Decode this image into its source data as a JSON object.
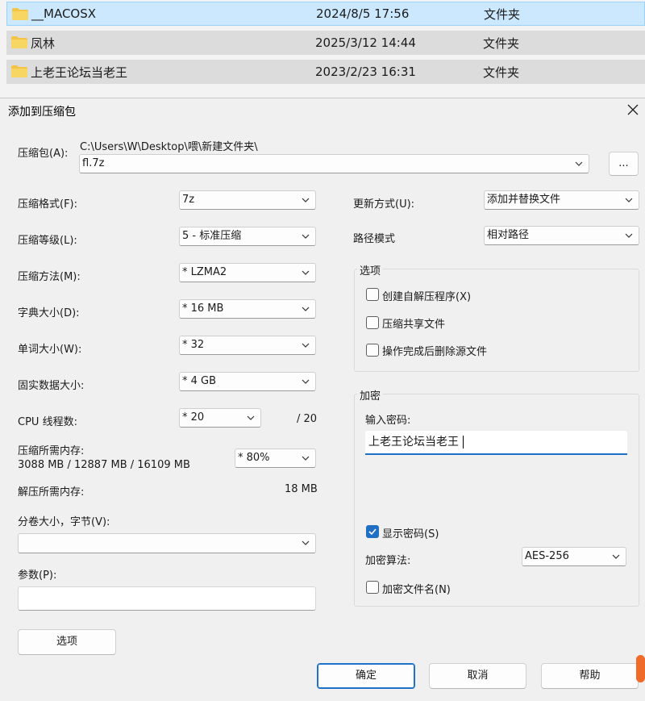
{
  "files": [
    {
      "name": "__MACOSX",
      "date": "2024/8/5 17:56",
      "type": "文件夹",
      "selected": true
    },
    {
      "name": "凤林",
      "date": "2025/3/12 14:44",
      "type": "文件夹",
      "selected": false
    },
    {
      "name": "上老王论坛当老王",
      "date": "2023/2/23 16:31",
      "type": "文件夹",
      "selected": false
    }
  ],
  "dialog": {
    "title": "添加到压缩包",
    "archive_label": "压缩包(A):",
    "archive_path": "C:\\Users\\W\\Desktop\\喂\\新建文件夹\\",
    "archive_name": "fl.7z",
    "browse_label": "...",
    "left": {
      "format_label": "压缩格式(F):",
      "format_value": "7z",
      "level_label": "压缩等级(L):",
      "level_value": "5 - 标准压缩",
      "method_label": "压缩方法(M):",
      "method_value": "* LZMA2",
      "dict_label": "字典大小(D):",
      "dict_value": "* 16 MB",
      "word_label": "单词大小(W):",
      "word_value": "* 32",
      "solid_label": "固实数据大小:",
      "solid_value": "* 4 GB",
      "threads_label": "CPU 线程数:",
      "threads_value": "* 20",
      "threads_total": "/ 20",
      "mem_label": "压缩所需内存:",
      "mem_detail": "3088 MB / 12887 MB / 16109 MB",
      "mem_value": "* 80%",
      "decomp_label": "解压所需内存:",
      "decomp_value": "18 MB",
      "volume_label": "分卷大小，字节(V):",
      "volume_value": "",
      "params_label": "参数(P):",
      "params_value": "",
      "options_button": "选项"
    },
    "right": {
      "update_label": "更新方式(U):",
      "update_value": "添加并替换文件",
      "path_label": "路径模式",
      "path_value": "相对路径",
      "options_group": "选项",
      "opt_sfx": "创建自解压程序(X)",
      "opt_shared": "压缩共享文件",
      "opt_delete": "操作完成后删除源文件",
      "encrypt_group": "加密",
      "password_label": "输入密码:",
      "password_value": "上老王论坛当老王",
      "show_password": "显示密码(S)",
      "algo_label": "加密算法:",
      "algo_value": "AES-256",
      "encrypt_names": "加密文件名(N)"
    },
    "buttons": {
      "ok": "确定",
      "cancel": "取消",
      "help": "帮助"
    }
  },
  "icons": {
    "folder": "folder-icon",
    "close": "close-icon",
    "chevron": "chevron-down-icon",
    "check": "check-icon"
  },
  "colors": {
    "accent": "#1f6fc5",
    "selection": "#cce8ff",
    "folder": "#f3c446"
  }
}
